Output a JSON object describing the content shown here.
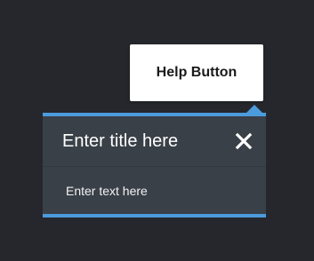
{
  "help_tooltip": {
    "label": "Help Button"
  },
  "popover": {
    "title": "Enter title here",
    "body_text": "Enter text here",
    "close_icon": "close-icon"
  },
  "colors": {
    "background": "#25272c",
    "panel": "#3a4048",
    "accent": "#4c9bdc",
    "tooltip_bg": "#ffffff",
    "tooltip_text": "#1a1a1a",
    "panel_text": "#ffffff"
  }
}
